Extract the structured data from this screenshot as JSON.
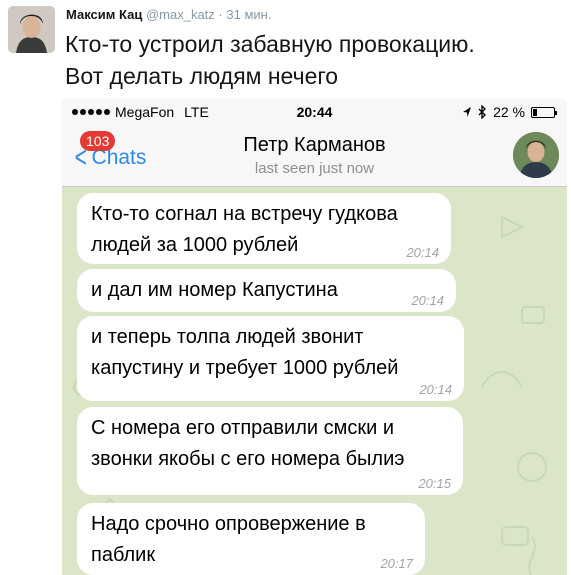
{
  "tweet": {
    "author": "Максим Кац",
    "handle": "@max_katz",
    "separator": "·",
    "time": "31 мин.",
    "text_line1": "Кто-то устроил забавную провокацию.",
    "text_line2": "Вот делать людям нечего"
  },
  "status_bar": {
    "carrier": "MegaFon",
    "network": "LTE",
    "time": "20:44",
    "battery": "22 %",
    "battery_level": 0.22,
    "icons": [
      "location-arrow-icon",
      "bluetooth-icon",
      "battery-icon",
      "signal-dots-icon"
    ]
  },
  "nav": {
    "back_label": "Chats",
    "badge": "103",
    "contact_name": "Петр Карманов",
    "last_seen": "last seen just now"
  },
  "messages": [
    {
      "text": "Кто-то согнал на встречу гудкова людей за 1000 рублей",
      "time": "20:14"
    },
    {
      "text": "и дал им номер Капустина",
      "time": "20:14"
    },
    {
      "text": "и теперь толпа людей звонит капустину и требует 1000 рублей",
      "time": "20:14"
    },
    {
      "text": "С номера его отправили смски и звонки якобы с его номера былиэ",
      "time": "20:15"
    },
    {
      "text": "Надо срочно опровержение в паблик",
      "time": "20:17"
    }
  ],
  "colors": {
    "accent": "#2c8be8",
    "badge": "#e53935",
    "chat_background": "#dbe6c9",
    "bubble": "#ffffff"
  }
}
